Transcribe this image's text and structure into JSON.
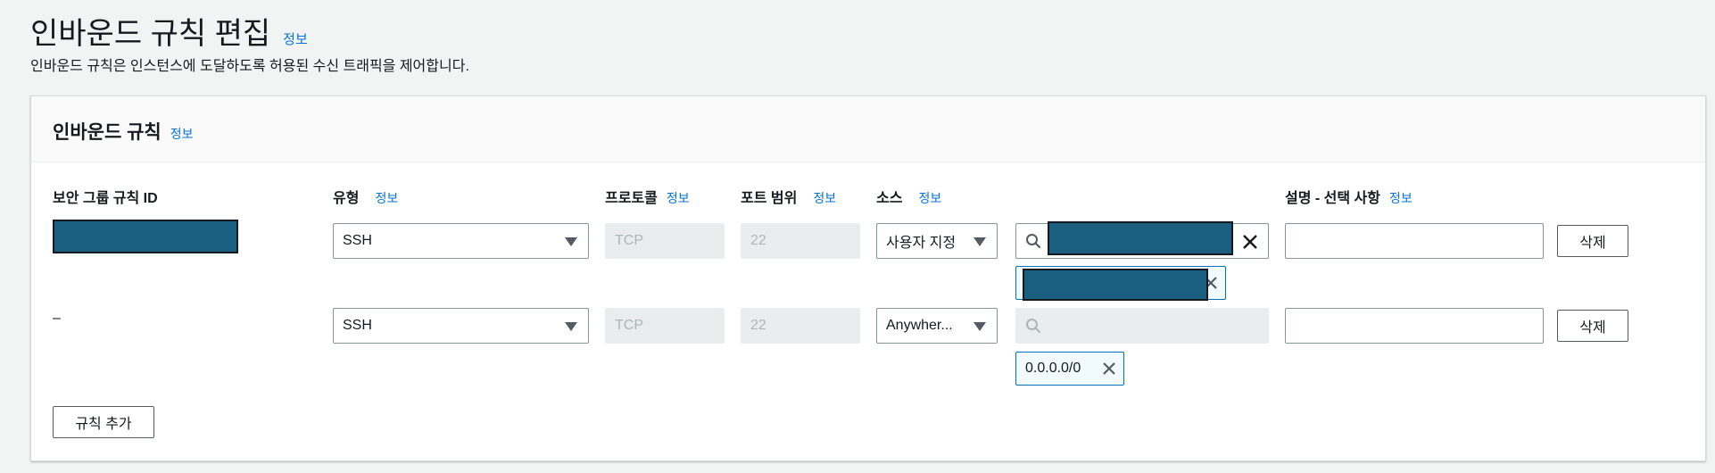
{
  "page": {
    "title": "인바운드 규칙 편집",
    "title_info": "정보",
    "description": "인바운드 규칙은 인스턴스에 도달하도록 허용된 수신 트래픽을 제어합니다."
  },
  "card": {
    "title": "인바운드 규칙",
    "title_info": "정보"
  },
  "columns": {
    "rule_id": "보안 그룹 규칙 ID",
    "type": "유형",
    "type_info": "정보",
    "protocol": "프로토콜",
    "protocol_info": "정보",
    "port_range": "포트 범위",
    "port_range_info": "정보",
    "source": "소스",
    "source_info": "정보",
    "description": "설명 - 선택 사항",
    "description_info": "정보"
  },
  "rows": [
    {
      "rule_id": "",
      "type": "SSH",
      "protocol": "TCP",
      "port": "22",
      "source": "사용자 지정",
      "token": "",
      "delete": "삭제"
    },
    {
      "rule_id": "–",
      "type": "SSH",
      "protocol": "TCP",
      "port": "22",
      "source": "Anywher...",
      "token": "0.0.0.0/0",
      "delete": "삭제"
    }
  ],
  "actions": {
    "add_rule": "규칙 추가"
  },
  "colors": {
    "link": "#0972d3",
    "redacted": "#1a5f7f",
    "token_border": "#0073bb"
  }
}
